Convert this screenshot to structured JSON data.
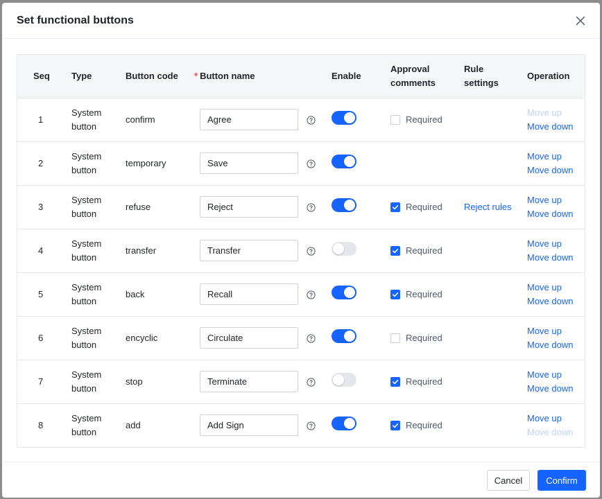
{
  "dialog": {
    "title": "Set functional buttons",
    "cancel_label": "Cancel",
    "confirm_label": "Confirm"
  },
  "columns": {
    "seq": "Seq",
    "type": "Type",
    "code": "Button code",
    "name_required_mark": "*",
    "name": "Button name",
    "enable": "Enable",
    "approval_line1": "Approval",
    "approval_line2": "comments",
    "rule_line1": "Rule",
    "rule_line2": "settings",
    "operation": "Operation"
  },
  "labels": {
    "type_line1": "System",
    "type_line2": "button",
    "required": "Required",
    "move_up": "Move up",
    "move_down": "Move down"
  },
  "colors": {
    "accent": "#1664ff",
    "link_disabled": "#bed3fb",
    "switch_off": "#e5e6eb",
    "required_mark": "#f54a45"
  },
  "rows": [
    {
      "seq": "1",
      "code": "confirm",
      "name": "Agree",
      "enabled": true,
      "approval": "unchecked",
      "rule": "",
      "up_disabled": true,
      "down_disabled": false
    },
    {
      "seq": "2",
      "code": "temporary",
      "name": "Save",
      "enabled": true,
      "approval": "none",
      "rule": "",
      "up_disabled": false,
      "down_disabled": false
    },
    {
      "seq": "3",
      "code": "refuse",
      "name": "Reject",
      "enabled": true,
      "approval": "checked",
      "rule": "Reject rules",
      "up_disabled": false,
      "down_disabled": false
    },
    {
      "seq": "4",
      "code": "transfer",
      "name": "Transfer",
      "enabled": false,
      "approval": "checked",
      "rule": "",
      "up_disabled": false,
      "down_disabled": false
    },
    {
      "seq": "5",
      "code": "back",
      "name": "Recall",
      "enabled": true,
      "approval": "checked",
      "rule": "",
      "up_disabled": false,
      "down_disabled": false
    },
    {
      "seq": "6",
      "code": "encyclic",
      "name": "Circulate",
      "enabled": true,
      "approval": "unchecked",
      "rule": "",
      "up_disabled": false,
      "down_disabled": false
    },
    {
      "seq": "7",
      "code": "stop",
      "name": "Terminate",
      "enabled": false,
      "approval": "checked",
      "rule": "",
      "up_disabled": false,
      "down_disabled": false
    },
    {
      "seq": "8",
      "code": "add",
      "name": "Add Sign",
      "enabled": true,
      "approval": "checked",
      "rule": "",
      "up_disabled": false,
      "down_disabled": true
    }
  ]
}
